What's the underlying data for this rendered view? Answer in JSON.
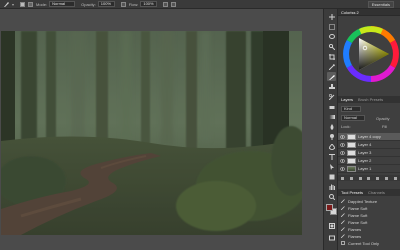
{
  "options_bar": {
    "mode_label": "Mode:",
    "mode_value": "Normal",
    "opacity_label": "Opacity:",
    "opacity_value": "100%",
    "flow_label": "Flow:",
    "flow_value": "100%",
    "workspace": "Essentials"
  },
  "color_panel": {
    "title": "Coloriss 2"
  },
  "layers_panel": {
    "tabs": [
      "Layers",
      "Brush Presets"
    ],
    "filter_value": "Kind",
    "blend_mode": "Normal",
    "opacity_label": "Opacity",
    "lock_label": "Lock:",
    "fill_label": "Fill",
    "layers": [
      {
        "name": "Layer 4 copy",
        "selected": true
      },
      {
        "name": "Layer 4",
        "selected": false
      },
      {
        "name": "Layer 3",
        "selected": false
      },
      {
        "name": "Layer 2",
        "selected": false
      },
      {
        "name": "Layer 1",
        "selected": false
      }
    ]
  },
  "tool_presets_panel": {
    "tabs": [
      "Tool Presets",
      "Channels"
    ],
    "presets": [
      "Dappled Texture",
      "Flame Soft",
      "Flame Soft",
      "Flame Soft",
      "Flames",
      "Flames"
    ],
    "footer": "Current Tool Only"
  },
  "colors": {
    "foreground": "#7a1a1a",
    "background": "#d8d8d8",
    "accent": "#3a8ee6"
  },
  "icons": {
    "tool_active": "brush-icon"
  }
}
